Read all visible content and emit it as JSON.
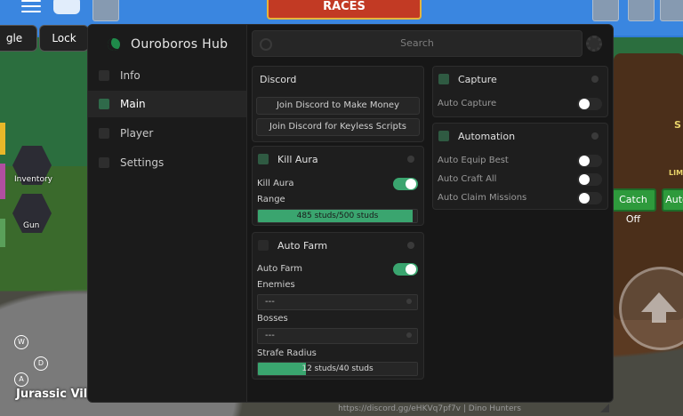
{
  "game": {
    "races_banner": "RACES",
    "buttons": {
      "toggle_partial": "gle",
      "lock": "Lock"
    },
    "hotbar": {
      "inventory": "Inventory",
      "gun": "Gun"
    },
    "location": "Jurassic Villa",
    "compass": [
      "W",
      "D",
      "A",
      "Q"
    ],
    "right_buttons": {
      "catch_off": "Catch Off",
      "auto_partial": "Auto"
    },
    "right_text": {
      "lim": "LIM",
      "s": "S"
    }
  },
  "hub": {
    "title": "Ouroboros Hub",
    "search": {
      "placeholder": "Search"
    },
    "nav": [
      {
        "label": "Info",
        "active": false
      },
      {
        "label": "Main",
        "active": true
      },
      {
        "label": "Player",
        "active": false
      },
      {
        "label": "Settings",
        "active": false
      }
    ],
    "discord": {
      "title": "Discord",
      "buttons": [
        "Join Discord to Make Money",
        "Join Discord for Keyless Scripts"
      ]
    },
    "kill_aura": {
      "title": "Kill Aura",
      "toggle_label": "Kill Aura",
      "toggle_on": true,
      "range_label": "Range",
      "range_text": "485 studs/500 studs",
      "range_value": 485,
      "range_max": 500
    },
    "auto_farm": {
      "title": "Auto Farm",
      "toggle_label": "Auto Farm",
      "toggle_on": true,
      "enemies_label": "Enemies",
      "enemies_value": "---",
      "bosses_label": "Bosses",
      "bosses_value": "---",
      "strafe_label": "Strafe Radius",
      "strafe_text": "12 studs/40 studs",
      "strafe_value": 12,
      "strafe_max": 40
    },
    "capture": {
      "title": "Capture",
      "auto_capture_label": "Auto Capture",
      "auto_capture_on": false
    },
    "automation": {
      "title": "Automation",
      "items": [
        {
          "label": "Auto Equip Best",
          "on": false
        },
        {
          "label": "Auto Craft All",
          "on": false
        },
        {
          "label": "Auto Claim Missions",
          "on": false
        }
      ]
    },
    "footer": "https://discord.gg/eHKVq7pf7v | Dino Hunters"
  },
  "colors": {
    "accent": "#3aa56f",
    "panel": "#1e1e1e",
    "window": "#171717"
  }
}
